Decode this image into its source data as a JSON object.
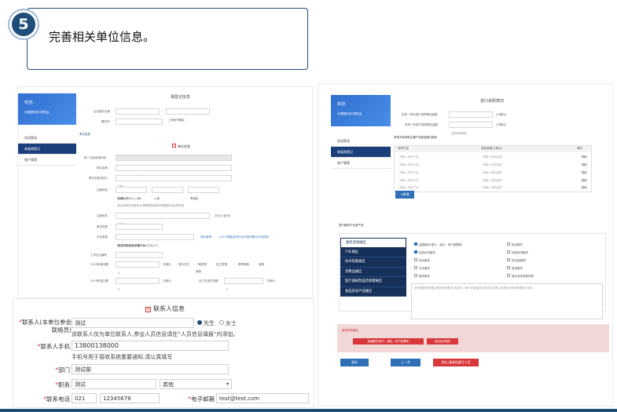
{
  "step": {
    "number": "5",
    "title": "完善相关单位信息。"
  },
  "left": {
    "sidebar": {
      "welcome": "欢迎,",
      "org": "中国国际进口博览会",
      "items": [
        "欢迎登录",
        "参展商登记",
        "账户管理"
      ]
    },
    "form_title": "报登记信息",
    "rows": {
      "exhibit_type_label": "企业展示分类",
      "exhibit_type_value": "上海全市图区",
      "exhibit_type_value2": "上海全市图区",
      "booth_label": "展位号",
      "section_label": "单位信息",
      "unit_section_icon": "单位信息",
      "credit_code_label": "统一社会信用代码",
      "credit_code_value": "9931013023151315234",
      "unit_name_label": "单位名称",
      "unit_name_value": "中国国际进口博览会",
      "unit_name_en_label": "单位名称(英文)",
      "unit_name_en_value": "CIIE",
      "address_label": "注册地址",
      "addr_prov": "上海",
      "addr_city": "上海",
      "addr_dist": "青浦区",
      "addr_detail": "国家会展中心(上海)",
      "addr_hint": "请认真填写注册地,在邮寄展会资料时需要填写此项内容",
      "capital_label": "注册资本",
      "capital_value": "1212",
      "capital_unit": "万元(人民币)",
      "nature_label": "单位性质",
      "nature_value": "事业单位",
      "industry_label": "行业类型",
      "industry_value": "新闻和出版业本地产业",
      "industry_link": "填写参考:",
      "industry_hint": "(2017国民经济行业分类详情)(行业类型)",
      "employees_hint": "员工人数:年营业额1000万元以下",
      "listed_label": "上市企业编号",
      "revenue_label": "2019年营业额",
      "revenue_value": "1",
      "revenue_unit": "万美元",
      "import_label": "进口方式",
      "import_options": [
        "一般贸易",
        "加工贸易",
        "跨境电商",
        "保税",
        "其他"
      ],
      "import_amount_label": "2019年进口额",
      "import_amount_value": "2",
      "import_amount_unit": "万美元",
      "import_amount3_label": "近三年进口总额",
      "import_amount3_value": "1",
      "import_amount3_unit": "万美元"
    }
  },
  "right": {
    "sidebar": {
      "welcome": "欢迎,",
      "org": "中国国际进口博览会",
      "items": [
        "欢迎登录",
        "参展商登记",
        "账户管理"
      ]
    },
    "form_title": "进口采购意向",
    "plan_label": "未来一年中进口采购预估金额",
    "plan_value": "1-5000万",
    "plan_unit": "(万美元)",
    "plan3_label": "未来三年进口采购预估金额",
    "plan3_value": "1万-5000万",
    "plan3_unit": "(万美元)",
    "table_title": "请填写拟采购主要产品和金额(选填)",
    "table_headers": [
      "采购产品",
      "采购金额(万美元)",
      "操作"
    ],
    "table_rows": [
      {
        "product": "请输入采购产品",
        "amount": "请输入采购金额",
        "op": "删除"
      },
      {
        "product": "请输入采购产品",
        "amount": "请输入采购金额",
        "op": "删除"
      },
      {
        "product": "请输入采购产品",
        "amount": "请输入采购金额",
        "op": "删除"
      },
      {
        "product": "请输入采购产品",
        "amount": "请输入采购金额",
        "op": "删除"
      },
      {
        "product": "请输入采购产品",
        "amount": "请输入采购金额",
        "op": "删除"
      }
    ],
    "add_button": "+新增",
    "industry_section": "感兴趣的行业和产品",
    "industry_menu": [
      "服务贸易展区",
      "汽车展区",
      "技术装备展区",
      "消费品展区",
      "医疗器械及医药保健展区",
      "食品及农产品展区"
    ],
    "checkbox_left": [
      "金融服务(银行、保险、资产管理等)",
      "信息技术服务",
      "综合服务",
      "文化服务",
      "教育服务"
    ],
    "checkbox_right": [
      "物流服务",
      "检验检测服务",
      "供应链管理",
      "旅游服务",
      "娱乐及体育服务等"
    ],
    "textarea_hint": "如有需要采购展区里的采购需求,请说明。我们可能通过对您提出方便以及满足您的采购需求(可选)",
    "selected_title": "服务贸易展区",
    "selected_tags": [
      "金融服务(银行、保险、资产管理等)",
      "信息技术服务"
    ],
    "buttons": {
      "save": "暂存",
      "prev": "上一步",
      "next": "保存,请继续填写人员"
    }
  },
  "contact": {
    "title": "联系人信息",
    "name_label": "联系人(本单位参会联络员)",
    "name_value": "测试",
    "gender_male": "先生",
    "gender_female": "女士",
    "name_note": "该联系人仅为单位联系人,参会人员信息请在“人员信息填报”内添加。",
    "mobile_label": "联系人手机",
    "mobile_value": "13800138000",
    "mobile_note": "手机号用于接收系统重要通知,请认真填写",
    "dept_label": "部门",
    "dept_value": "测试部",
    "title_label": "职务",
    "title_value": "测试",
    "title_select": "其他",
    "phone_label": "联系电话",
    "phone_area": "021",
    "phone_value": "12345678",
    "email_label": "电子邮箱",
    "email_value": "test@test.com"
  },
  "colors": {
    "navy": "#1f4e79",
    "blue": "#2f6fb5",
    "red": "#d9383a",
    "pink_band": "#f2d7d7"
  }
}
